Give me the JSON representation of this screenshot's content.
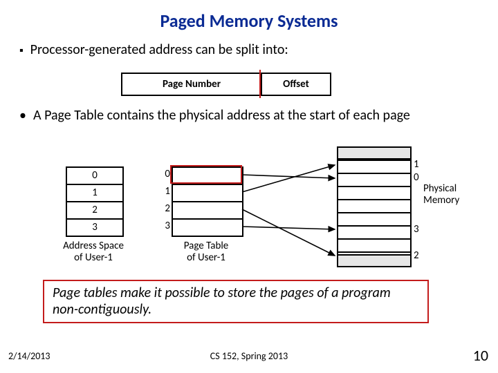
{
  "title": "Paged Memory Systems",
  "bullets": {
    "b1": "Processor-generated address can be split into:",
    "b2": "A Page Table contains the physical address at the start of each page"
  },
  "address_box": {
    "page_number": "Page Number",
    "offset": "Offset"
  },
  "address_space": {
    "rows": {
      "r0": "0",
      "r1": "1",
      "r2": "2",
      "r3": "3"
    },
    "label": "Address Space\nof User-1"
  },
  "page_table": {
    "idx": {
      "i0": "0",
      "i1": "1",
      "i2": "2",
      "i3": "3"
    },
    "label": "Page Table\nof User-1"
  },
  "physical_memory": {
    "labels": {
      "n1": "1",
      "n0": "0",
      "n3": "3",
      "n2": "2"
    },
    "title": "Physical\nMemory"
  },
  "callout": "Page tables make it possible to store the pages of a program non-contiguously.",
  "footer": {
    "date": "2/14/2013",
    "course": "CS 152, Spring 2013",
    "slide": "10"
  }
}
